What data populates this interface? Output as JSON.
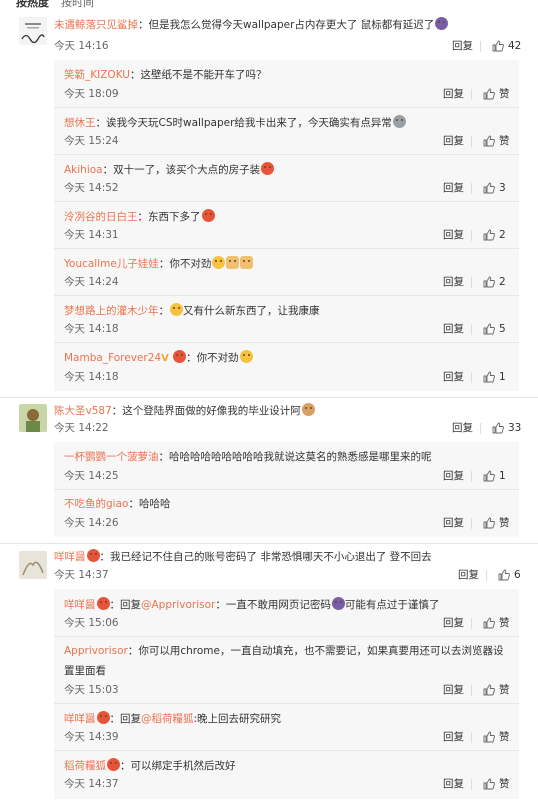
{
  "tabs": {
    "hot": "按热度",
    "time": "按时间"
  },
  "reply_label": "回复",
  "zan_label": "赞",
  "comments": [
    {
      "name": "未遇鲸落只见鲨掉",
      "text": "但是我怎么觉得今天wallpaper占内存更大了 鼠标都有延迟了",
      "time": "今天 14:16",
      "likes": "42"
    },
    {
      "name": "陈大圣v587",
      "text": "这个登陆界面做的好像我的毕业设计阿",
      "time": "今天 14:22",
      "likes": "33"
    },
    {
      "name": "咩咩醤",
      "text": "我已经记不住自己的账号密码了 非常恐惧哪天不小心退出了 登不回去",
      "time": "今天 14:37",
      "likes": "6"
    }
  ],
  "replies1": [
    {
      "name": "笑簕_KIZOKU",
      "text": "这壁纸不是不能开车了吗？",
      "time": "今天 18:09",
      "likes": "赞"
    },
    {
      "name": "想休王",
      "text": "诶我今天玩CS时wallpaper给我卡出来了，今天确实有点异常",
      "time": "今天 15:24",
      "likes": "赞"
    },
    {
      "name": "Akihioa",
      "text": "双十一了，该买个大点的房子装",
      "time": "今天 14:52",
      "likes": "3"
    },
    {
      "name": "泠冽谷的日白王",
      "text": "东西下多了",
      "time": "今天 14:31",
      "likes": "2"
    },
    {
      "name": "Youcallme儿子娃娃",
      "text": "你不对劲",
      "time": "今天 14:24",
      "likes": "2"
    },
    {
      "name": "梦想路上的灌木少年",
      "text": "又有什么新东西了，让我康康",
      "time": "今天 14:18",
      "likes": "5"
    },
    {
      "name": "Mamba_Forever24",
      "text": "你不对劲",
      "time": "今天 14:18",
      "likes": "1"
    }
  ],
  "replies2": [
    {
      "name": "一杯鹦鹦一个菠萝油",
      "text": "哈哈哈哈哈哈哈哈哈我就说这莫名的熟悉感是哪里来的呢",
      "time": "今天 14:25",
      "likes": "1"
    },
    {
      "name": "不吃鱼的giao",
      "text": "哈哈哈",
      "time": "今天 14:26",
      "likes": "赞"
    }
  ],
  "replies3": [
    {
      "name": "咩咩醤",
      "prefix": "回复",
      "mention": "@Apprivorisor",
      "text": "一直不敢用网页记密码",
      "text2": "可能有点过于谨慎了",
      "time": "今天 15:06",
      "likes": "赞"
    },
    {
      "name": "Apprivorisor",
      "text": "你可以用chrome，一直自动填充，也不需要记，如果真要用还可以去浏览器设",
      "text_line2": "置里面看",
      "time": "今天 15:03",
      "likes": "赞"
    },
    {
      "name": "咩咩醤",
      "prefix": "回复",
      "mention": "@稻荷糧狐",
      "text": "晚上回去研究研究",
      "time": "今天 14:39",
      "likes": "赞"
    },
    {
      "name": "稻荷糧狐",
      "text": "可以绑定手机然后改好",
      "time": "今天 14:37",
      "likes": "赞"
    }
  ]
}
